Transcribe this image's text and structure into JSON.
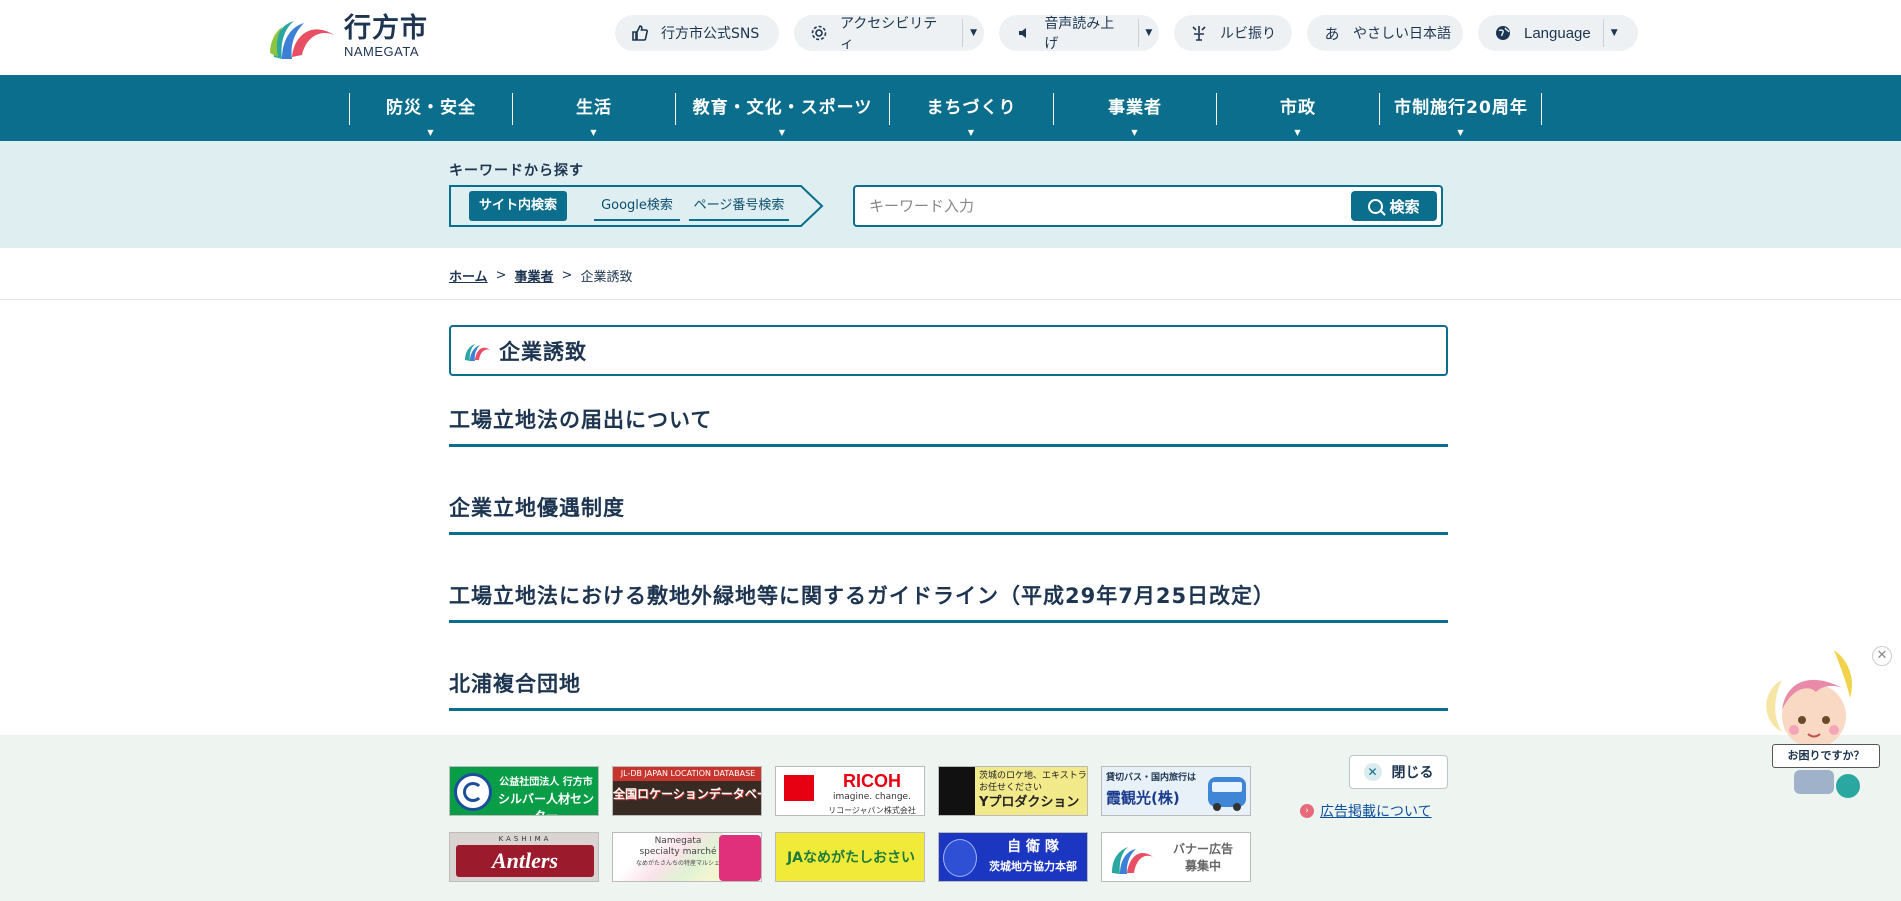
{
  "logo": {
    "name_jp": "行方市",
    "name_en": "NAMEGATA"
  },
  "utility": [
    {
      "label": "行方市公式SNS",
      "icon": "thumbs-up-icon"
    },
    {
      "label": "アクセシビリティ",
      "icon": "gear-icon"
    },
    {
      "label": "音声読み上げ",
      "icon": "speaker-icon"
    },
    {
      "label": "ルビ振り",
      "icon": "ruby-icon"
    },
    {
      "label": "やさしい日本語",
      "icon": "hiragana-a-icon"
    },
    {
      "label": "Language",
      "icon": "globe-icon"
    }
  ],
  "gnav": [
    "防災・安全",
    "生活",
    "教育・文化・スポーツ",
    "まちづくり",
    "事業者",
    "市政",
    "市制施行20周年"
  ],
  "search": {
    "title": "キーワードから探す",
    "tabs": [
      "サイト内検索",
      "Google検索",
      "ページ番号検索"
    ],
    "placeholder": "キーワード入力",
    "button": "検索"
  },
  "breadcrumb": {
    "home": "ホーム",
    "parent": "事業者",
    "current": "企業誘致",
    "sep": ">"
  },
  "page_title": "企業誘致",
  "links": [
    "工場立地法の届出について",
    "企業立地優遇制度",
    "工場立地法における敷地外緑地等に関するガイドライン（平成29年7月25日改定）",
    "北浦複合団地"
  ],
  "banners": {
    "silver_org": "公益社団法人 行方市",
    "silver_name": "シルバー人材センター",
    "location_top": "JL-DB JAPAN LOCATION DATABASE",
    "location_main": "全国ロケーションデータベース",
    "ricoh": "RICOH",
    "ricoh_tag": "imagine. change.",
    "ricoh_sub": "リコージャパン株式会社",
    "ypro_text1": "茨城のロケ地、エキストラ",
    "ypro_text2": "お任せください",
    "ypro_name": "Yプロダクション",
    "kasumi_top": "貸切バス・国内旅行は",
    "kasumi_name": "霞観光(株)",
    "antlers_top": "KASHIMA",
    "antlers": "Antlers",
    "marche_1": "Namegata",
    "marche_2": "specialty marché",
    "marche_3": "なめがたさんちの特産マルシェ",
    "ja": "JAなめがたしおさい",
    "jsdf_1": "自 衛 隊",
    "jsdf_2": "茨城地方協力本部",
    "recruit_1": "バナー広告",
    "recruit_2": "募集中"
  },
  "ad_close": "閉じる",
  "ad_info": "広告掲載について",
  "helper_label": "お困りですか？",
  "colors": {
    "primary": "#0b6e8c",
    "text": "#1d3550",
    "search_bg": "#deeef1",
    "banner_bg": "#eef5f1"
  }
}
